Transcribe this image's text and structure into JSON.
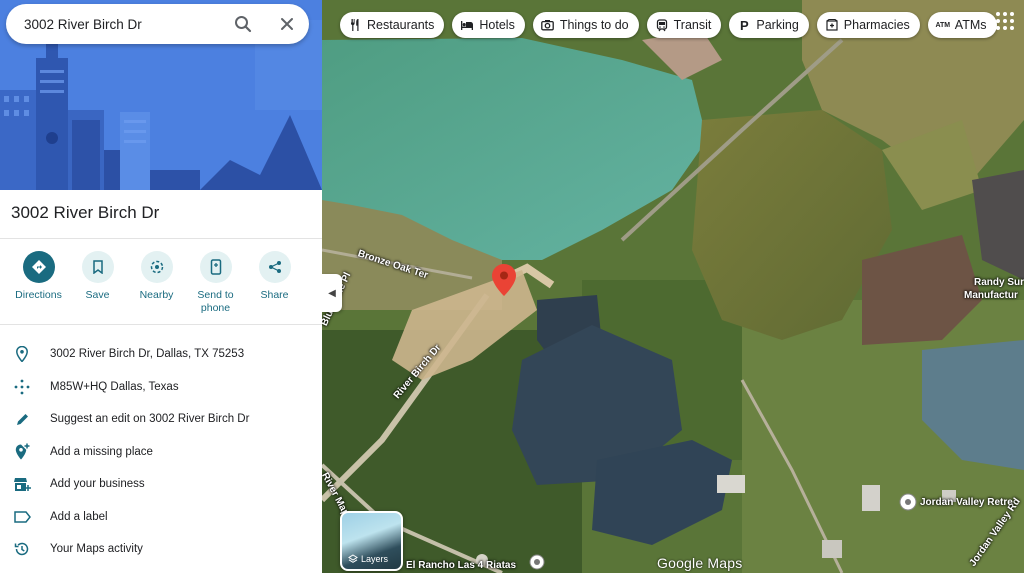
{
  "search": {
    "value": "3002 River Birch Dr",
    "search_icon": "search-icon",
    "close_icon": "close-icon"
  },
  "place": {
    "title": "3002 River Birch Dr"
  },
  "actions": [
    {
      "label": "Directions",
      "icon": "directions-icon"
    },
    {
      "label": "Save",
      "icon": "bookmark-icon"
    },
    {
      "label": "Nearby",
      "icon": "nearby-icon"
    },
    {
      "label": "Send to phone",
      "icon": "phone-icon"
    },
    {
      "label": "Share",
      "icon": "share-icon"
    }
  ],
  "info": [
    {
      "text": "3002 River Birch Dr, Dallas, TX 75253",
      "icon": "location-pin-icon"
    },
    {
      "text": "M85W+HQ Dallas, Texas",
      "icon": "plus-code-icon"
    },
    {
      "text": "Suggest an edit on 3002 River Birch Dr",
      "icon": "pencil-icon"
    },
    {
      "text": "Add a missing place",
      "icon": "add-place-icon"
    },
    {
      "text": "Add your business",
      "icon": "add-business-icon"
    },
    {
      "text": "Add a label",
      "icon": "label-icon"
    },
    {
      "text": "Your Maps activity",
      "icon": "history-icon"
    }
  ],
  "chips": [
    {
      "label": "Restaurants",
      "icon": "fork-knife-icon"
    },
    {
      "label": "Hotels",
      "icon": "bed-icon"
    },
    {
      "label": "Things to do",
      "icon": "camera-icon"
    },
    {
      "label": "Transit",
      "icon": "train-icon"
    },
    {
      "label": "Parking",
      "icon": "parking-icon"
    },
    {
      "label": "Pharmacies",
      "icon": "pharmacy-icon"
    },
    {
      "label": "ATMs",
      "icon": "atm-icon"
    }
  ],
  "map": {
    "streets": {
      "bronze_oak": "Bronze Oak Ter",
      "blue_pine": "Blue Pine Pl",
      "river_birch": "River Birch Dr",
      "river_maple": "River Maple Ln",
      "jordan_valley_rd": "Jordan Valley Rd"
    },
    "places": {
      "randy_1": "Randy Sur",
      "randy_2": "Manufactur",
      "jordan_retreat": "Jordan Valley Retre",
      "el_rancho": "El Rancho Las 4 Riatas"
    },
    "layers_label": "Layers",
    "logo": "Google Maps"
  },
  "colors": {
    "accent": "#1a6b80",
    "hero_sky": "#4c80e0",
    "pin": "#ea4335"
  }
}
